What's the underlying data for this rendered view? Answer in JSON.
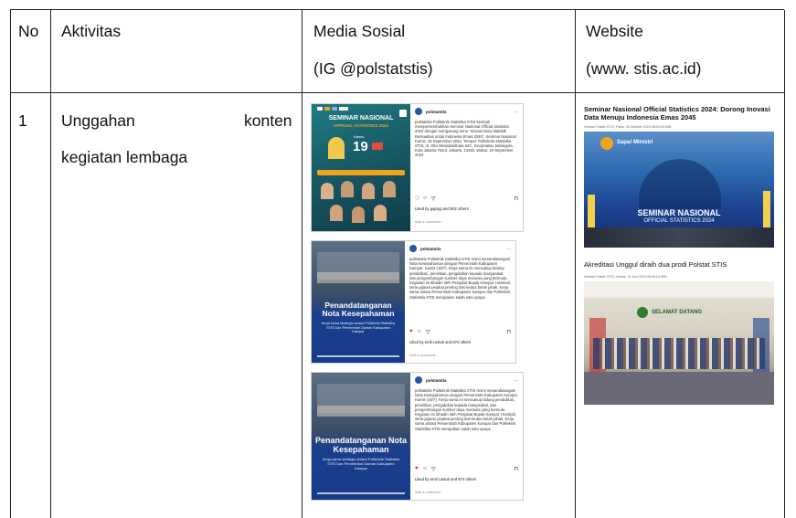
{
  "table": {
    "headers": {
      "no": "No",
      "aktivitas": "Aktivitas",
      "media_line1": "Media Sosial",
      "media_line2": "(IG @polstatstis)",
      "web_line1": "Website",
      "web_line2": "(www. stis.ac.id)"
    },
    "row1": {
      "no": "1",
      "aktivitas_word1": "Unggahan",
      "aktivitas_word2": "konten",
      "aktivitas_line2": "kegiatan lembaga"
    }
  },
  "instagram_posts": [
    {
      "username": "polstatstis",
      "image_title": "SEMINAR NASIONAL",
      "image_subtitle": "OFFICIAL STATISTICS 2024",
      "date_day": "19",
      "date_label": "Kamis,",
      "caption": "polstatstis Politeknik Statistika STIS kembali mempersembahkan Seminar Nasional Official Statistics 2024 dengan mengusung tema \"Inovasi Data Statistik Berkualitas untuk Indonesia Emas 2045\". Seminar Nasional Kamis, 19 September 2024. Tempat: Politeknik Statistika STIS, Jl. Otto Iskandardinata 64C, Kecamatan Jatinegara, Kota Jakarta Timur, Jakarta, 13330. Waktu: 19 September 2024",
      "liked_by": "Liked by gapryg and 602 others",
      "add_comment": "Add a comment..."
    },
    {
      "username": "polstatstis",
      "image_title": "Penandatanganan Nota Kesepahaman",
      "image_subtitle": "Kerja sama strategis antara Politeknik Statistika STIS Dan Pemerintah Daerah Kabupaten Kampar",
      "caption": "polstatstis Politeknik Statistika STIS resmi menandatangani Nota Kesepahaman dengan Pemerintah Kabupaten Kampar, Kamis (16/7). Kerja sama ini mencakup bidang pendidikan, penelitian, pengabdian kepada masyarakat, dan pengembangan sumber daya manusia yang bermutu. Kegiatan ini dihadiri oleh Penjabat Bupati Kampar, Hambali, serta jajaran pejabat penting dari kedua belah pihak. Kerja sama antara Pemerintah Kabupaten Kampar dan Politeknik Statistika STIS merupakan salah satu upaya.",
      "liked_by": "Liked by emil.t.astuti and 874 others",
      "add_comment": "Add a comment..."
    },
    {
      "username": "polstatstis",
      "image_title": "Penandatanganan Nota Kesepahaman",
      "image_subtitle": "Kerja sama strategis antara Politeknik Statistika STIS Dan Pemerintah Daerah Kabupaten Kampar",
      "caption": "polstatstis Politeknik Statistika STIS resmi menandatangani Nota Kesepahaman dengan Pemerintah Kabupaten Kampar, Kamis (16/7). Kerja sama ini mencakup bidang pendidikan, penelitian, pengabdian kepada masyarakat, dan pengembangan sumber daya manusia yang bermutu. Kegiatan ini dihadiri oleh Penjabat Bupati Kampar, Hambali, serta jajaran pejabat penting dari kedua belah pihak. Kerja sama antara Pemerintah Kabupaten Kampar dan Politeknik Statistika STIS merupakan salah satu upaya.",
      "liked_by": "Liked by emil.t.astuti and 874 others",
      "add_comment": "Add a comment..."
    }
  ],
  "website_posts": [
    {
      "title": "Seminar Nasional Official Statistics 2024: Dorong Inovasi Data Menuju Indonesia Emas 2045",
      "meta": "Humas Polstat STIS | Rabu, 25 Oktober 2024 08:00:18 WIB",
      "banner_small": "Sapa! Ministri",
      "banner_big1": "SEMINAR NASIONAL",
      "banner_big2": "OFFICIAL STATISTICS 2024"
    },
    {
      "title": "Akreditasi Unggul diraih dua prodi Polstat STIS",
      "meta": "Humas Polstat STIS | Kamis, 13 Juni 2024 08:09:14 WIB",
      "banner_small": "SELAMAT DATANG"
    }
  ],
  "colors": {
    "grid": "#222222",
    "polstat_blue": "#1b3f8c",
    "seminar_teal": "#1f6f7a",
    "accent_orange": "#f2a31c",
    "like_red": "#e0245e"
  }
}
